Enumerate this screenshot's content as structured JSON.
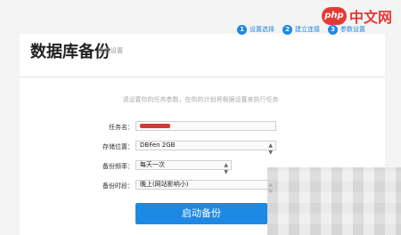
{
  "steps": [
    {
      "num": "1",
      "label": "设置选择"
    },
    {
      "num": "2",
      "label": "建立连接"
    },
    {
      "num": "3",
      "label": "参数设置"
    }
  ],
  "page": {
    "title": "数据库备份",
    "subtitle": "参数设置"
  },
  "hint": "请设置你的任务参数，在你的计划将根据设置来执行任务",
  "form": {
    "task_name_label": "任务名：",
    "storage_label": "存储位置：",
    "storage_value": "DBFen 2GB",
    "frequency_label": "备份频率：",
    "frequency_value": "每天一次",
    "time_label": "备份时段：",
    "time_value": "晚上(网站影响小)"
  },
  "submit_label": "启动备份",
  "watermark": {
    "badge": "php",
    "text": "中文网"
  },
  "colors": {
    "accent": "#1e88e5",
    "watermark": "#e53935"
  }
}
